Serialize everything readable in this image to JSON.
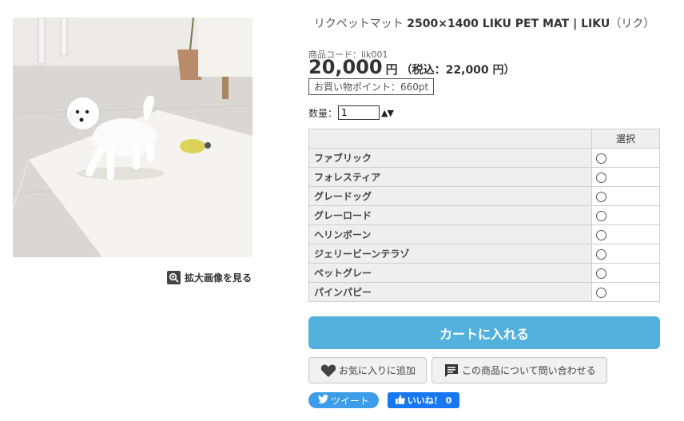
{
  "product": {
    "title_plain": "リクペットマット",
    "title_bold": "2500×1400 LIKU PET MAT | LIKU",
    "title_suffix": "（リク）",
    "code_text": "商品コード：lik001",
    "price": "20,000",
    "price_unit": "円",
    "price_tax_included": "（税込：22,000 円）",
    "points_text": "お買い物ポイント：660pt"
  },
  "image": {
    "zoom_label": "拡大画像を見る"
  },
  "quantity": {
    "label": "数量：",
    "value": "1",
    "stepper": "▲▼"
  },
  "options": {
    "header_select": "選択",
    "items": [
      {
        "label": "ファブリック"
      },
      {
        "label": "フォレスティア"
      },
      {
        "label": "グレードッグ"
      },
      {
        "label": "グレーロード"
      },
      {
        "label": "ヘリンボーン"
      },
      {
        "label": "ジェリービーンテラゾ"
      },
      {
        "label": "ペットグレー"
      },
      {
        "label": "パインパピー"
      }
    ]
  },
  "actions": {
    "cart_label": "カートに入れる",
    "favorite_label": "お気に入りに追加",
    "inquiry_label": "この商品について問い合わせる",
    "tweet_label": "ツイート",
    "like_label": "いいね！ 0"
  },
  "colors": {
    "cart_button": "#54b0dd",
    "tweet_button": "#3c9ce8",
    "like_button": "#1877f2",
    "table_header_bg": "#efefef"
  },
  "icons": [
    "zoom-icon",
    "heart-icon",
    "chat-icon",
    "twitter-bird-icon",
    "thumbs-up-icon"
  ]
}
